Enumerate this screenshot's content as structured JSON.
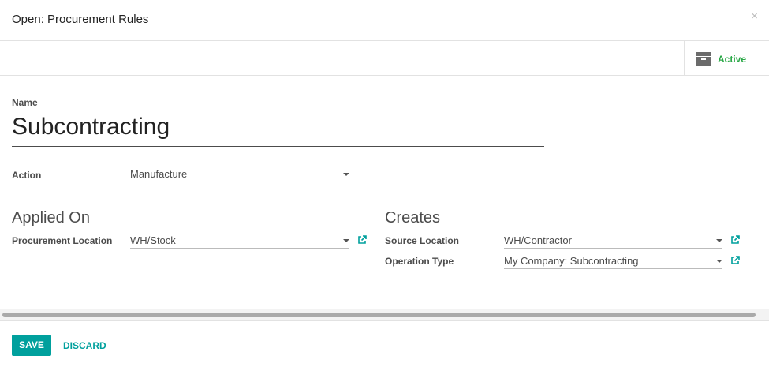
{
  "dialog": {
    "title": "Open: Procurement Rules",
    "close": "×"
  },
  "button_box": {
    "active_label": "Active"
  },
  "form": {
    "name_label": "Name",
    "name_value": "Subcontracting",
    "action_label": "Action",
    "action_value": "Manufacture",
    "applied_on": {
      "title": "Applied On",
      "procurement_location_label": "Procurement Location",
      "procurement_location_value": "WH/Stock"
    },
    "creates": {
      "title": "Creates",
      "source_location_label": "Source Location",
      "source_location_value": "WH/Contractor",
      "operation_type_label": "Operation Type",
      "operation_type_value": "My Company: Subcontracting"
    }
  },
  "footer": {
    "save_label": "SAVE",
    "discard_label": "DISCARD"
  },
  "colors": {
    "primary": "#00a09d",
    "active_green": "#28a745"
  },
  "icons": {
    "archive": "archive-icon",
    "external_link": "external-link-icon",
    "dropdown": "caret-down-icon"
  }
}
